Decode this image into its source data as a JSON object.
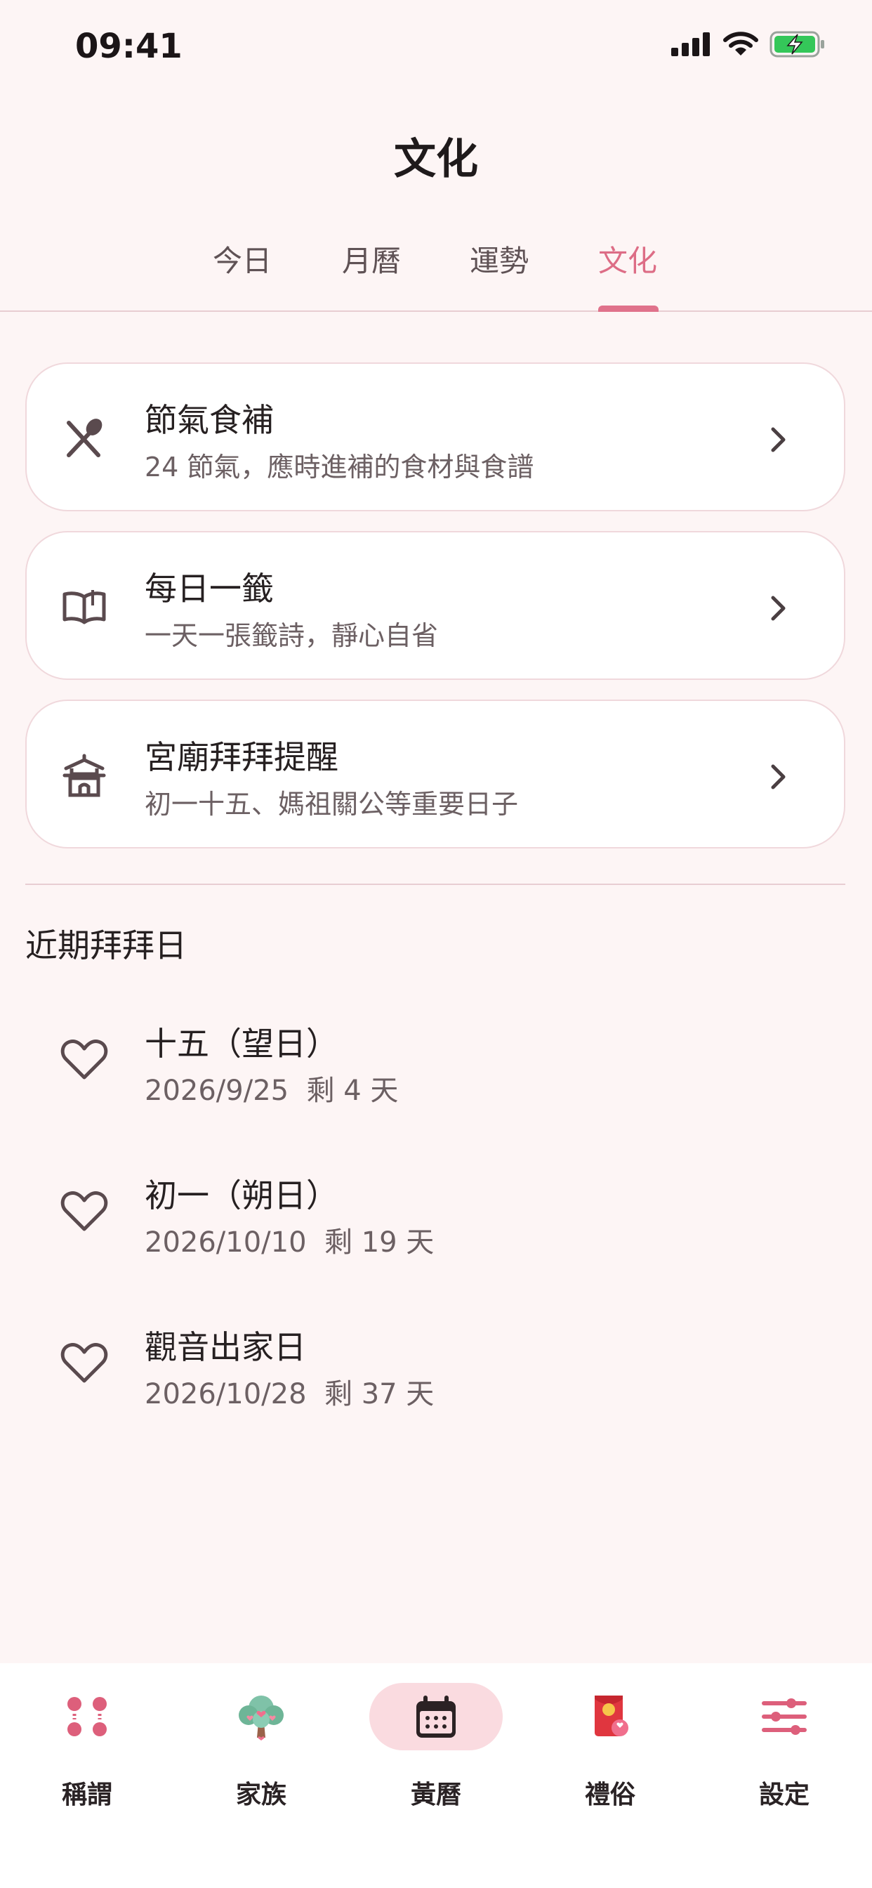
{
  "status": {
    "time": "09:41"
  },
  "header": {
    "title": "文化"
  },
  "tabs": [
    {
      "label": "今日"
    },
    {
      "label": "月曆"
    },
    {
      "label": "運勢"
    },
    {
      "label": "文化"
    }
  ],
  "active_tab": "文化",
  "cards": [
    {
      "title": "節氣食補",
      "subtitle": "24 節氣，應時進補的食材與食譜",
      "icon": "utensils-icon"
    },
    {
      "title": "每日一籤",
      "subtitle": "一天一張籤詩，靜心自省",
      "icon": "open-book-icon"
    },
    {
      "title": "宮廟拜拜提醒",
      "subtitle": "初一十五、媽祖關公等重要日子",
      "icon": "temple-icon"
    }
  ],
  "upcoming": {
    "title": "近期拜拜日",
    "items": [
      {
        "title": "十五（望日）",
        "date": "2026/9/25",
        "remaining": "剩 4 天"
      },
      {
        "title": "初一（朔日）",
        "date": "2026/10/10",
        "remaining": "剩 19 天"
      },
      {
        "title": "觀音出家日",
        "date": "2026/10/28",
        "remaining": "剩 37 天"
      }
    ]
  },
  "bottom_nav": [
    {
      "label": "稱謂",
      "icon": "dots-grid-icon"
    },
    {
      "label": "家族",
      "icon": "family-tree-icon"
    },
    {
      "label": "黃曆",
      "icon": "calendar-icon"
    },
    {
      "label": "禮俗",
      "icon": "red-envelope-icon"
    },
    {
      "label": "設定",
      "icon": "sliders-icon"
    }
  ],
  "active_nav": "黃曆",
  "colors": {
    "accent": "#dd6d86",
    "background": "#fdf5f5",
    "nav_active_bg": "#fadbe0"
  }
}
